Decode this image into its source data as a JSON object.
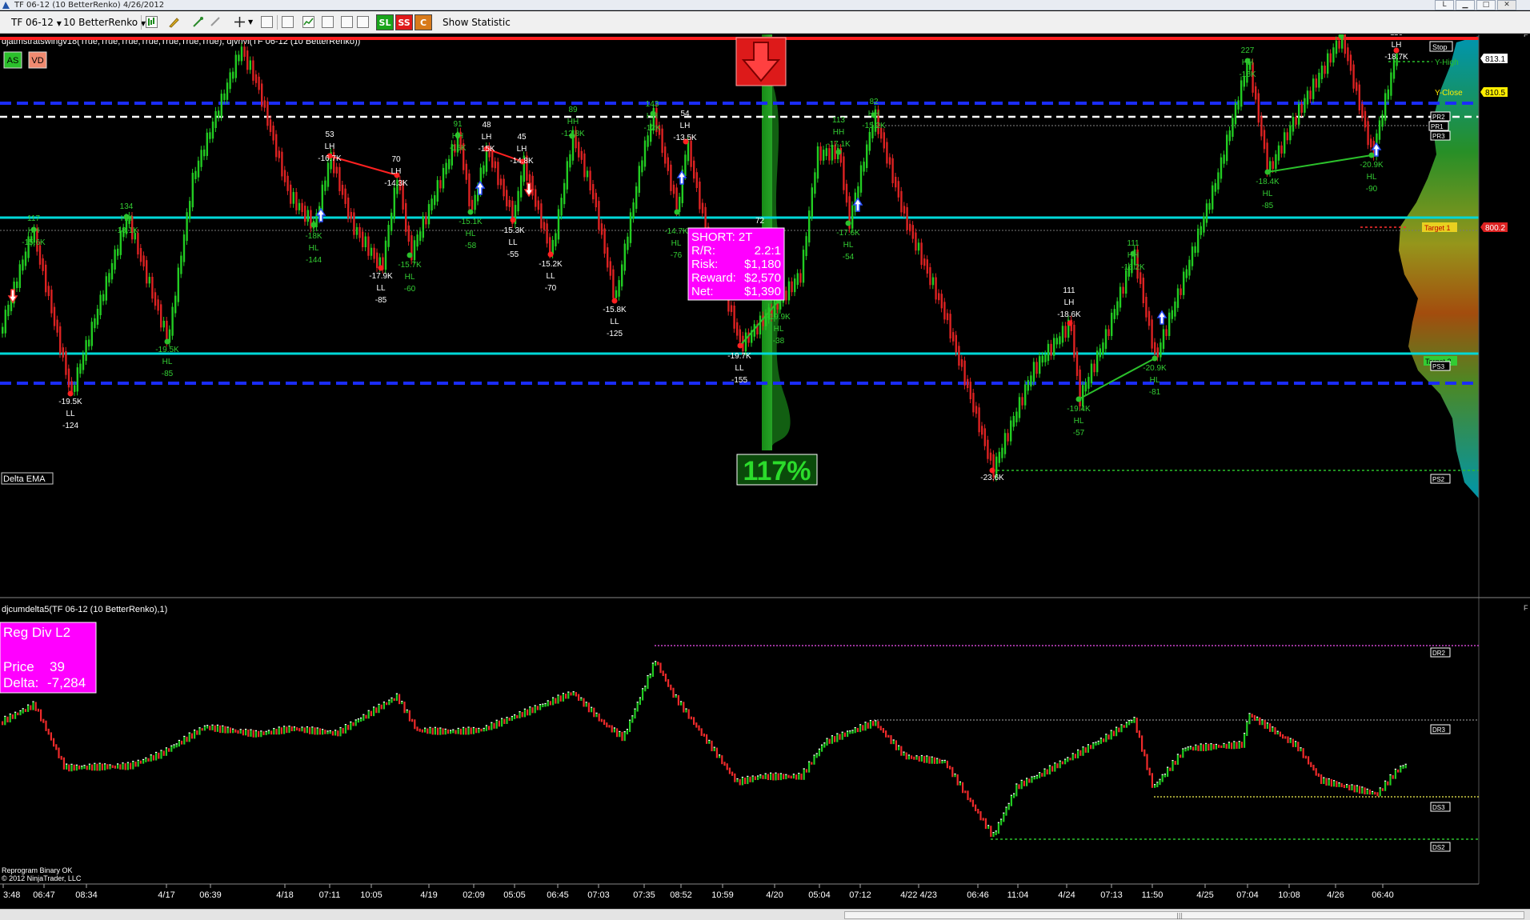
{
  "window": {
    "title": "TF 06-12 (10 BetterRenko)  4/26/2012",
    "controls": [
      "L",
      "▁",
      "□",
      "✕"
    ]
  },
  "toolbar": {
    "instrument": "TF 06-12",
    "period": "10 BetterRenko",
    "sl_label": "SL",
    "ss_label": "SS",
    "c_label": "C",
    "show_statistic": "Show Statistic"
  },
  "colors": {
    "bull": "#22cc22",
    "bear": "#dd2222",
    "stop_line": "#ff2020",
    "cyan_line": "#00d8d8",
    "blue_dash": "#1a2cff",
    "magenta": "#ff00ff",
    "label_green": "#33cc33"
  },
  "top_panel": {
    "indicator_label": "djatmstratswingv18(True,True,True,True,True,True,True), djvhvl(TF 06-12 (10 BetterRenko))",
    "badge_as": "AS",
    "badge_vd": "VD",
    "delta_ema": "Delta EMA",
    "percent_box": "117%",
    "f_marker": "F",
    "trade_box": {
      "lines": [
        {
          "k": "SHORT: 2T",
          "v": ""
        },
        {
          "k": "R/R:",
          "v": "2.2:1"
        },
        {
          "k": "Risk:",
          "v": "$1,180"
        },
        {
          "k": "Reward:",
          "v": "$2,570"
        },
        {
          "k": "Net:",
          "v": "$1,390"
        }
      ],
      "extra": "72"
    },
    "price_tags": [
      {
        "text": "813.1",
        "bg": "#ffffff",
        "fg": "#000000"
      },
      {
        "text": "810.5",
        "bg": "#ffee00",
        "fg": "#000000"
      },
      {
        "text": "800.2",
        "bg": "#dd2222",
        "fg": "#ffffff"
      }
    ],
    "level_labels": {
      "stop": "Stop",
      "y_high": "Y-High",
      "y_close": "Y-Close",
      "pr2": "PR2",
      "pr1": "PR1",
      "pr3": "PR3",
      "target1": "Target 1",
      "target2": "Target 2",
      "ps3": "PS3",
      "ps2": "PS2"
    },
    "swing_labels": [
      {
        "t": [
          "117",
          "HH",
          "-15.6K"
        ],
        "c": "g"
      },
      {
        "t": [
          "134",
          "HH",
          "-18.1K"
        ],
        "c": "g"
      },
      {
        "t": [
          "53",
          "LH",
          "-16.7K"
        ],
        "c": "w"
      },
      {
        "t": [
          "70",
          "LH",
          "-14.3K"
        ],
        "c": "w"
      },
      {
        "t": [
          "91",
          "HH",
          "-15K"
        ],
        "c": "g"
      },
      {
        "t": [
          "48",
          "LH",
          "-15K"
        ],
        "c": "w"
      },
      {
        "t": [
          "45",
          "LH",
          "-14.8K"
        ],
        "c": "w"
      },
      {
        "t": [
          "89",
          "HH",
          "-12.8K"
        ],
        "c": "g"
      },
      {
        "t": [
          "143",
          "HH",
          "-12K"
        ],
        "c": "g"
      },
      {
        "t": [
          "54",
          "LH",
          "-13.5K"
        ],
        "c": "w"
      },
      {
        "t": [
          "113",
          "HH",
          "-17.1K"
        ],
        "c": "g"
      },
      {
        "t": [
          "82",
          "HH",
          "-15.2K"
        ],
        "c": "g"
      },
      {
        "t": [
          "111",
          "LH",
          "-18.6K"
        ],
        "c": "w"
      },
      {
        "t": [
          "111",
          "HH",
          "-16.2K"
        ],
        "c": "g"
      },
      {
        "t": [
          "227",
          "HH",
          "-16K"
        ],
        "c": "g"
      },
      {
        "t": [
          "116",
          "LH",
          "-18.7K"
        ],
        "c": "w"
      },
      {
        "t": [
          "-19.5K",
          "LL",
          "-124"
        ],
        "c": "w"
      },
      {
        "t": [
          "-19.5K",
          "HL",
          "-85"
        ],
        "c": "g"
      },
      {
        "t": [
          "-18K",
          "HL",
          "-144"
        ],
        "c": "g"
      },
      {
        "t": [
          "-17.9K",
          "LL",
          "-85"
        ],
        "c": "w"
      },
      {
        "t": [
          "-15.7K",
          "HL",
          "-60"
        ],
        "c": "g"
      },
      {
        "t": [
          "-15.1K",
          "HL",
          "-58"
        ],
        "c": "g"
      },
      {
        "t": [
          "-15.3K",
          "LL",
          "-55"
        ],
        "c": "w"
      },
      {
        "t": [
          "-15.2K",
          "LL",
          "-70"
        ],
        "c": "w"
      },
      {
        "t": [
          "-15.8K",
          "LL",
          "-125"
        ],
        "c": "w"
      },
      {
        "t": [
          "-14.7K",
          "HL",
          "-76"
        ],
        "c": "g"
      },
      {
        "t": [
          "-19.7K",
          "LL",
          "-155"
        ],
        "c": "w"
      },
      {
        "t": [
          "-19.9K",
          "HL",
          "-38"
        ],
        "c": "g"
      },
      {
        "t": [
          "-17.6K",
          "HL",
          "-54"
        ],
        "c": "g"
      },
      {
        "t": [
          "-23.6K"
        ],
        "c": "w"
      },
      {
        "t": [
          "-19.4K",
          "HL",
          "-57"
        ],
        "c": "g"
      },
      {
        "t": [
          "-20.9K",
          "HL",
          "-81"
        ],
        "c": "g"
      },
      {
        "t": [
          "-18.4K",
          "HL",
          "-85"
        ],
        "c": "g"
      },
      {
        "t": [
          "-20.9K",
          "HL",
          "-90"
        ],
        "c": "g"
      }
    ]
  },
  "bottom_panel": {
    "indicator_label": "djcumdelta5(TF 06-12 (10 BetterRenko),1)",
    "f_marker": "F",
    "reg_div": {
      "title": "Reg Div L2",
      "price_label": "Price",
      "price_value": "39",
      "delta_label": "Delta:",
      "delta_value": "-7,284"
    },
    "level_labels": {
      "dr2": "DR2",
      "dr3": "DR3",
      "ds3": "DS3",
      "ds2": "DS2"
    },
    "status_line": "Reprogram Binary OK",
    "copyright": "© 2012 NinjaTrader, LLC"
  },
  "x_axis": {
    "ticks": [
      "3:48",
      "06:47",
      "08:34",
      "4/17",
      "06:39",
      "4/18",
      "07:11",
      "10:05",
      "4/19",
      "02:09",
      "05:05",
      "06:45",
      "07:03",
      "07:35",
      "08:52",
      "10:59",
      "4/20",
      "05:04",
      "07:12",
      "4/22 4/23",
      "06:46",
      "11:04",
      "4/24",
      "07:13",
      "11:50",
      "4/25",
      "07:04",
      "10:08",
      "4/26",
      "06:40"
    ]
  }
}
